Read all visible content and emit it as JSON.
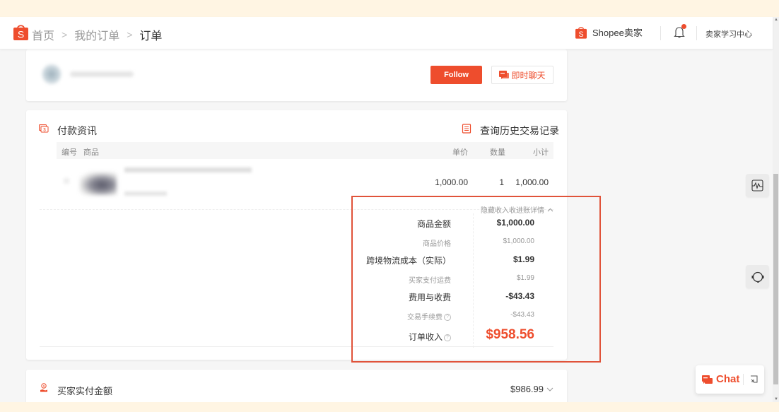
{
  "header": {
    "breadcrumb": [
      "首页",
      "我的订单",
      "订单"
    ],
    "brand_label": "Shopee卖家",
    "learning_center": "卖家学习中心",
    "has_notification": true
  },
  "buyer_card": {
    "follow_label": "Follow",
    "chat_label": "即时聊天"
  },
  "payment_card": {
    "title": "付款资讯",
    "history_link": "查询历史交易记录",
    "columns": {
      "index": "编号",
      "product": "商品",
      "unit_price": "单价",
      "quantity": "数量",
      "subtotal": "小计"
    },
    "items": [
      {
        "unit_price": "1,000.00",
        "quantity": "1",
        "subtotal": "1,000.00"
      }
    ],
    "toggle_detail_label": "隐藏收入收进账详情",
    "income_rows": [
      {
        "label": "商品金额",
        "value": "$1,000.00",
        "level": 1
      },
      {
        "label": "商品价格",
        "value": "$1,000.00",
        "level": 2
      },
      {
        "label": "跨境物流成本（实际）",
        "value": "$1.99",
        "level": 1
      },
      {
        "label": "买家支付运费",
        "value": "$1.99",
        "level": 2
      },
      {
        "label": "费用与收费",
        "value": "-$43.43",
        "level": 1
      },
      {
        "label": "交易手续费",
        "value": "-$43.43",
        "level": 2,
        "help": true
      }
    ],
    "order_income": {
      "label": "订单收入",
      "value": "$958.56",
      "help": true
    }
  },
  "buyer_payment_card": {
    "title": "买家实付金额",
    "amount": "$986.99"
  },
  "floating": {
    "chat_label": "Chat"
  },
  "colors": {
    "brand": "#ee4d2d",
    "highlight_box": "#e0533a",
    "banner": "#fff5e3"
  }
}
